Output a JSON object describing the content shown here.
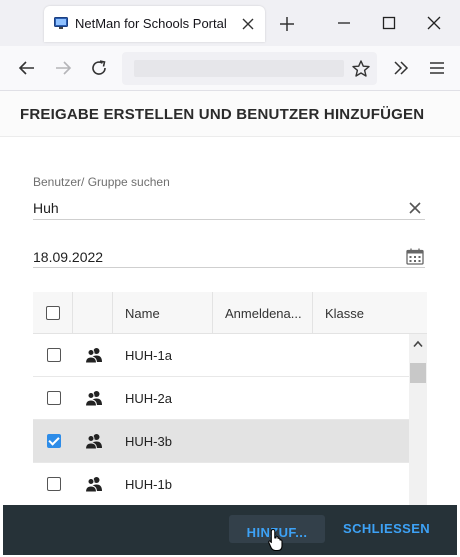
{
  "browser": {
    "tab_title": "NetMan for Schools Portal"
  },
  "page": {
    "title": "FREIGABE ERSTELLEN UND BENUTZER HINZUFÜGEN",
    "search": {
      "label": "Benutzer/ Gruppe suchen",
      "value": "Huh"
    },
    "date": {
      "value": "18.09.2022"
    },
    "grid": {
      "columns": [
        "Name",
        "Anmeldena...",
        "Klasse"
      ],
      "rows": [
        {
          "name": "HUH-1a",
          "checked": false
        },
        {
          "name": "HUH-2a",
          "checked": false
        },
        {
          "name": "HUH-3b",
          "checked": true
        },
        {
          "name": "HUH-1b",
          "checked": false
        }
      ]
    },
    "footer": {
      "add_label": "HINZUF...",
      "close_label": "SCHLIESSEN"
    }
  },
  "colors": {
    "accent": "#3da2f6",
    "footer_bg": "#263238",
    "checkbox_checked": "#2d8ce8"
  }
}
